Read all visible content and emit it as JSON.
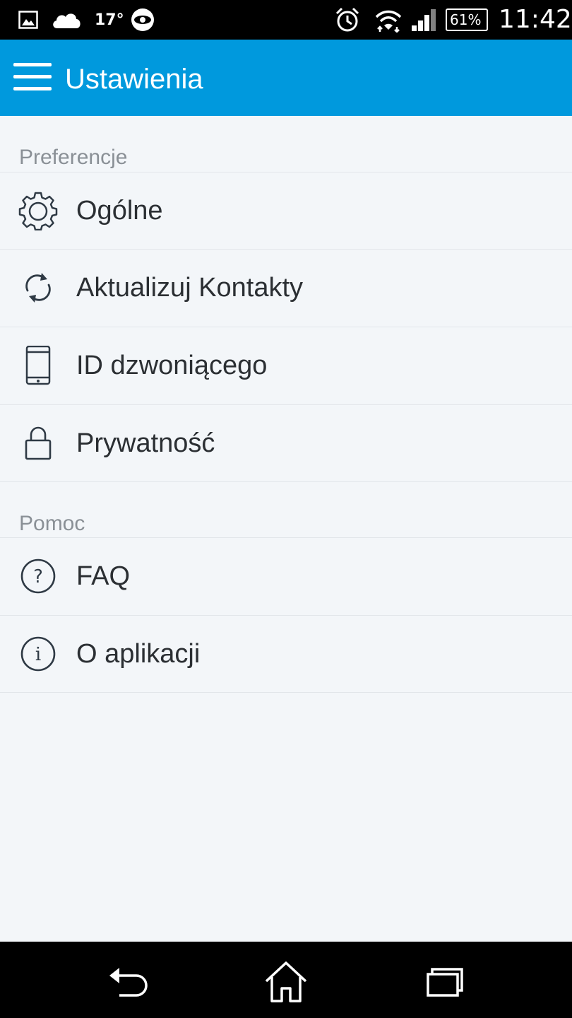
{
  "status_bar": {
    "temperature": "17°",
    "battery": "61%",
    "time": "11:42",
    "icons": [
      "gallery-icon",
      "cloud-icon",
      "eye-icon",
      "alarm-icon",
      "wifi-icon",
      "signal-icon",
      "battery-icon"
    ]
  },
  "app_bar": {
    "title": "Ustawienia",
    "menu_icon": "hamburger-icon",
    "color": "#0099dd"
  },
  "sections": [
    {
      "header": "Preferencje",
      "items": [
        {
          "label": "Ogólne",
          "icon": "gear-icon"
        },
        {
          "label": "Aktualizuj Kontakty",
          "icon": "sync-icon"
        },
        {
          "label": "ID dzwoniącego",
          "icon": "phone-icon"
        },
        {
          "label": "Prywatność",
          "icon": "lock-icon"
        }
      ]
    },
    {
      "header": "Pomoc",
      "items": [
        {
          "label": "FAQ",
          "icon": "question-icon"
        },
        {
          "label": "O aplikacji",
          "icon": "info-icon"
        }
      ]
    }
  ],
  "nav_bar": {
    "buttons": [
      "back-icon",
      "home-icon",
      "recents-icon"
    ]
  }
}
